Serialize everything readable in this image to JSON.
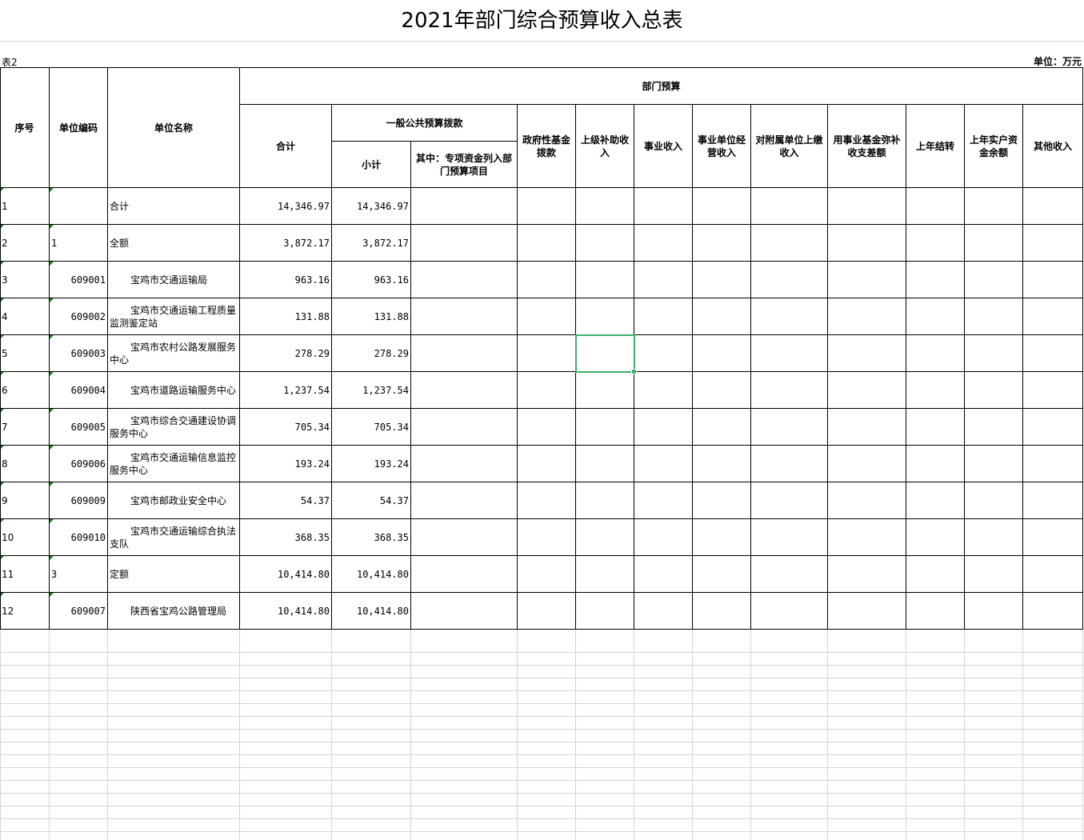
{
  "title": "2021年部门综合预算收入总表",
  "table_no": "表2",
  "unit": "单位：万元",
  "headers": {
    "seq": "序号",
    "code": "单位编码",
    "name": "单位名称",
    "dept_budget": "部门预算",
    "total": "合计",
    "general_public": "一般公共预算拨款",
    "subtotal": "小计",
    "special_funds": "其中：专项资金列入部门预算项目",
    "gov_fund": "政府性基金拨款",
    "superior_subsidy": "上级补助收入",
    "business_income": "事业收入",
    "operating_income": "事业单位经营收入",
    "affiliated_income": "对附属单位上缴收入",
    "fund_balance": "用事业基金弥补收支差额",
    "carryover": "上年结转",
    "prior_balance": "上年实户资金余额",
    "other_income": "其他收入"
  },
  "rows": [
    {
      "seq": "1",
      "code": "",
      "name": "合计",
      "total": "14,346.97",
      "subtotal": "14,346.97"
    },
    {
      "seq": "2",
      "code": "1",
      "name": "全额",
      "total": "3,872.17",
      "subtotal": "3,872.17"
    },
    {
      "seq": "3",
      "code": "609001",
      "name": "宝鸡市交通运输局",
      "total": "963.16",
      "subtotal": "963.16"
    },
    {
      "seq": "4",
      "code": "609002",
      "name": "宝鸡市交通运输工程质量监测鉴定站",
      "total": "131.88",
      "subtotal": "131.88"
    },
    {
      "seq": "5",
      "code": "609003",
      "name": "宝鸡市农村公路发展服务中心",
      "total": "278.29",
      "subtotal": "278.29"
    },
    {
      "seq": "6",
      "code": "609004",
      "name": "宝鸡市道路运输服务中心",
      "total": "1,237.54",
      "subtotal": "1,237.54"
    },
    {
      "seq": "7",
      "code": "609005",
      "name": "宝鸡市综合交通建设协调服务中心",
      "total": "705.34",
      "subtotal": "705.34"
    },
    {
      "seq": "8",
      "code": "609006",
      "name": "宝鸡市交通运输信息监控服务中心",
      "total": "193.24",
      "subtotal": "193.24"
    },
    {
      "seq": "9",
      "code": "609009",
      "name": "宝鸡市邮政业安全中心",
      "total": "54.37",
      "subtotal": "54.37"
    },
    {
      "seq": "10",
      "code": "609010",
      "name": "宝鸡市交通运输综合执法支队",
      "total": "368.35",
      "subtotal": "368.35"
    },
    {
      "seq": "11",
      "code": "3",
      "name": "定额",
      "total": "10,414.80",
      "subtotal": "10,414.80"
    },
    {
      "seq": "12",
      "code": "609007",
      "name": "陕西省宝鸡公路管理局",
      "total": "10,414.80",
      "subtotal": "10,414.80"
    }
  ],
  "colors": {
    "selection": "#3fae6e",
    "gridline": "#d4d4d4",
    "comment_marker": "#1d7a1d"
  }
}
